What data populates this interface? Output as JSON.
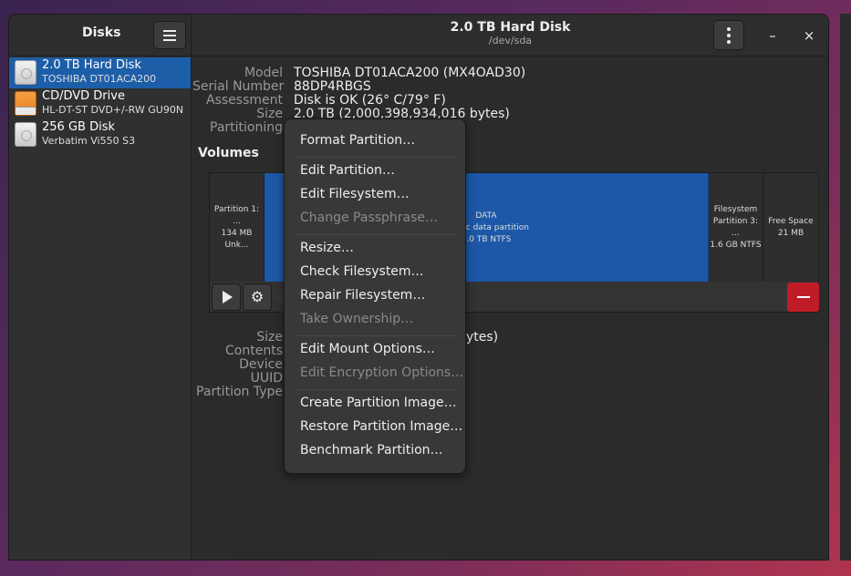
{
  "sidebar": {
    "title": "Disks",
    "disks": [
      {
        "name": "2.0 TB Hard Disk",
        "subtitle": "TOSHIBA DT01ACA200",
        "icon": "hdd-icon",
        "selected": true
      },
      {
        "name": "CD/DVD Drive",
        "subtitle": "HL-DT-ST DVD+/-RW GU90N",
        "icon": "optical-drive-icon",
        "selected": false
      },
      {
        "name": "256 GB Disk",
        "subtitle": "Verbatim Vi550 S3",
        "icon": "hdd-icon",
        "selected": false
      }
    ]
  },
  "header": {
    "title": "2.0 TB Hard Disk",
    "subtitle": "/dev/sda",
    "minimize": "–",
    "close": "×"
  },
  "disk_info": {
    "model_label": "Model",
    "model": "TOSHIBA DT01ACA200 (MX4OAD30)",
    "serial_label": "Serial Number",
    "serial": "88DP4RBGS",
    "assessment_label": "Assessment",
    "assessment": "Disk is OK (26° C/79° F)",
    "size_label": "Size",
    "size": "2.0 TB (2,000,398,934,016 bytes)",
    "partitioning_label": "Partitioning"
  },
  "volumes": {
    "title": "Volumes",
    "segments": [
      {
        "line1": "Partition 1: ...",
        "line2": "134 MB Unk..."
      },
      {
        "line1": "DATA",
        "line2": ": Basic data partition",
        "line3": "2.0 TB NTFS"
      },
      {
        "line1": "Filesystem",
        "line2": "Partition 3: ...",
        "line3": "1.6 GB NTFS"
      },
      {
        "line1": "Free Space",
        "line2": "21 MB"
      }
    ]
  },
  "partition_info": {
    "size_label": "Size",
    "size_value_tail": "ytes)",
    "contents_label": "Contents",
    "device_label": "Device",
    "uuid_label": "UUID",
    "type_label": "Partition Type"
  },
  "menu": {
    "items": [
      {
        "label": "Format Partition…",
        "enabled": true
      },
      {
        "label": "Edit Partition…",
        "enabled": true
      },
      {
        "label": "Edit Filesystem…",
        "enabled": true
      },
      {
        "label": "Change Passphrase…",
        "enabled": false
      },
      {
        "label": "Resize…",
        "enabled": true
      },
      {
        "label": "Check Filesystem…",
        "enabled": true
      },
      {
        "label": "Repair Filesystem…",
        "enabled": true
      },
      {
        "label": "Take Ownership…",
        "enabled": false
      },
      {
        "label": "Edit Mount Options…",
        "enabled": true
      },
      {
        "label": "Edit Encryption Options…",
        "enabled": false
      },
      {
        "label": "Create Partition Image…",
        "enabled": true
      },
      {
        "label": "Restore Partition Image…",
        "enabled": true
      },
      {
        "label": "Benchmark Partition…",
        "enabled": true
      }
    ]
  },
  "colors": {
    "accent": "#1d5ea8",
    "danger": "#c01c28"
  }
}
